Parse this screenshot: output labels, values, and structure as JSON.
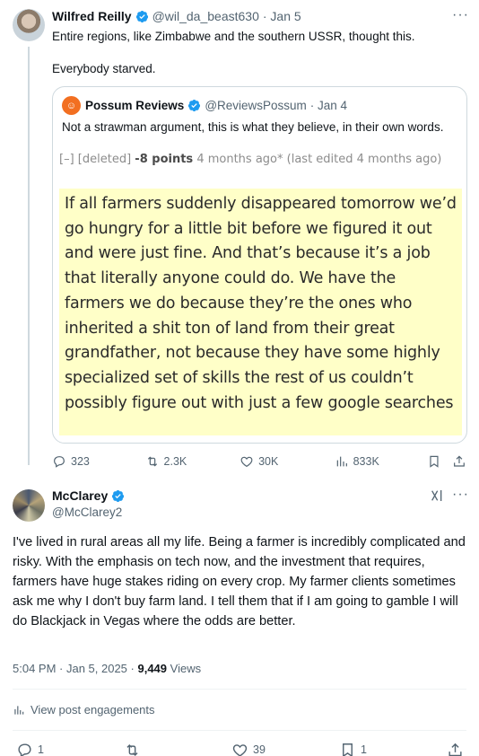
{
  "tweet1": {
    "name": "Wilfred Reilly",
    "handle": "@wil_da_beast630",
    "date": "· Jan 5",
    "line1": "Entire regions, like Zimbabwe and the southern USSR, thought this.",
    "line2": "Everybody starved.",
    "quote": {
      "name": "Possum Reviews",
      "handle": "@ReviewsPossum",
      "date": "· Jan 4",
      "text": "Not a strawman argument, this is what they believe, in their own words.",
      "reddit": {
        "collapse": "[–]",
        "user": "[deleted]",
        "points": "-8 points",
        "age": "4 months ago*",
        "edited": "(last edited 4 months ago)",
        "body": "If all farmers suddenly disappeared tomorrow we’d go hungry for a little bit before we figured it out and were just fine. And that’s because it’s a job that literally anyone could do. We have the farmers we do because they’re the ones who inherited a shit ton of land from their great grandfather, not because they have some highly specialized set of skills the rest of us couldn’t possibly figure out with just a few google searches"
      }
    },
    "replies": "323",
    "reposts": "2.3K",
    "likes": "30K",
    "views": "833K"
  },
  "tweet2": {
    "name": "McClarey",
    "handle": "@McClarey2",
    "text": "I've lived in rural areas all my life.  Being a farmer is incredibly complicated and risky.  With the emphasis on tech now, and the investment that requires, farmers have huge stakes riding on every crop.  My farmer clients sometimes ask me why I don't buy farm land.  I tell them that if I am going to gamble I will do Blackjack in Vegas where the odds are better.",
    "time": "5:04 PM · Jan 5, 2025 ·",
    "views_count": "9,449",
    "views_label": "Views",
    "engagements": "View post engagements",
    "replies": "1",
    "reposts": "",
    "likes": "39",
    "bookmarks": "1"
  },
  "colors": {
    "verified": "#1d9bf0",
    "text": "#0f1419",
    "muted": "#536471",
    "highlight": "#ffffc8",
    "possum_orange": "#f26f21"
  },
  "icons": [
    "verified-badge-icon",
    "more-icon",
    "reply-icon",
    "repost-icon",
    "like-icon",
    "views-icon",
    "bookmark-icon",
    "share-icon",
    "grok-icon"
  ]
}
